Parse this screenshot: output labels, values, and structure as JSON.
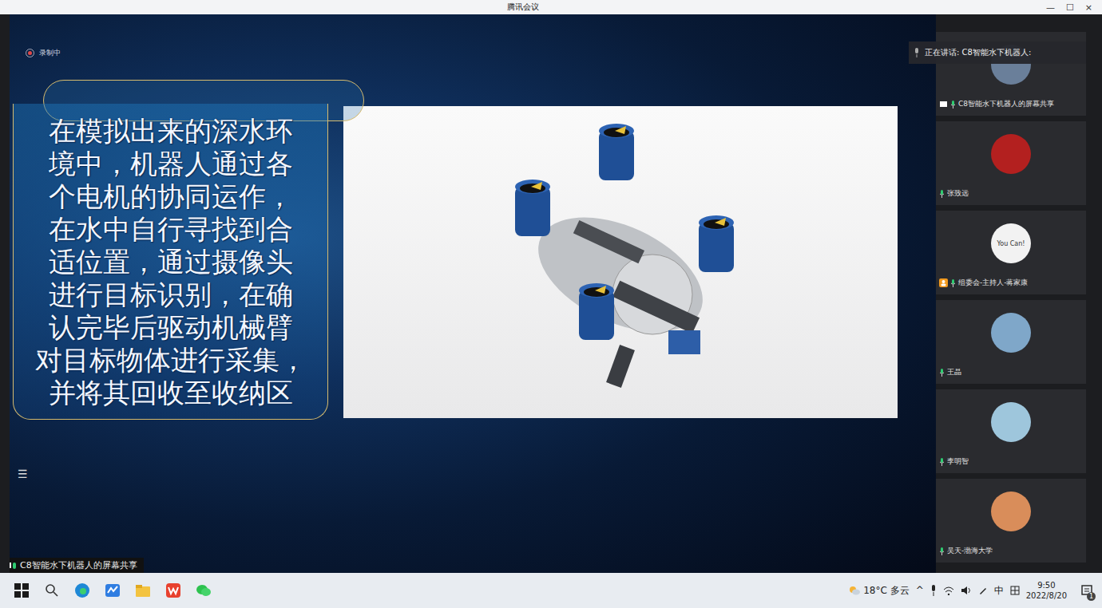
{
  "window": {
    "title": "腾讯会议",
    "controls": [
      "—",
      "☐",
      "×"
    ]
  },
  "recording": {
    "label": "录制中",
    "on": true
  },
  "slide": {
    "lines": [
      "在模拟出来的深水环",
      "境中，机器人通过各",
      "个电机的协同运作，",
      "在水中自行寻找到合",
      "适位置，通过摄像头",
      "进行目标识别，在确",
      "认完毕后驱动机械臂",
      "对目标物体进行采集，",
      "并将其回收至收纳区"
    ],
    "menu_icon": "☰"
  },
  "share_label": "C8智能水下机器人的屏幕共享",
  "speaking": "正在讲话: C8智能水下机器人:",
  "participants": [
    {
      "name": "C8智能水下机器人的屏幕共享",
      "avatar_text": "",
      "color": "#6a7f9a",
      "kind": "share"
    },
    {
      "name": "张致远",
      "avatar_text": "",
      "color": "#b3201f",
      "kind": "member"
    },
    {
      "name": "组委会-主持人-蒋家康",
      "avatar_text": "You Can!",
      "color": "#f2f2f2",
      "kind": "host"
    },
    {
      "name": "王晶",
      "avatar_text": "",
      "color": "#7fa7c9",
      "kind": "member"
    },
    {
      "name": "李明智",
      "avatar_text": "",
      "color": "#9ec6dc",
      "kind": "member"
    },
    {
      "name": "吴天-渤海大学",
      "avatar_text": "",
      "color": "#d98d5a",
      "kind": "member"
    }
  ],
  "taskbar": {
    "weather": "18°C 多云",
    "tray_arrow": "^",
    "ime": "中",
    "time": "9:50",
    "date": "2022/8/20",
    "notifications": "1"
  }
}
